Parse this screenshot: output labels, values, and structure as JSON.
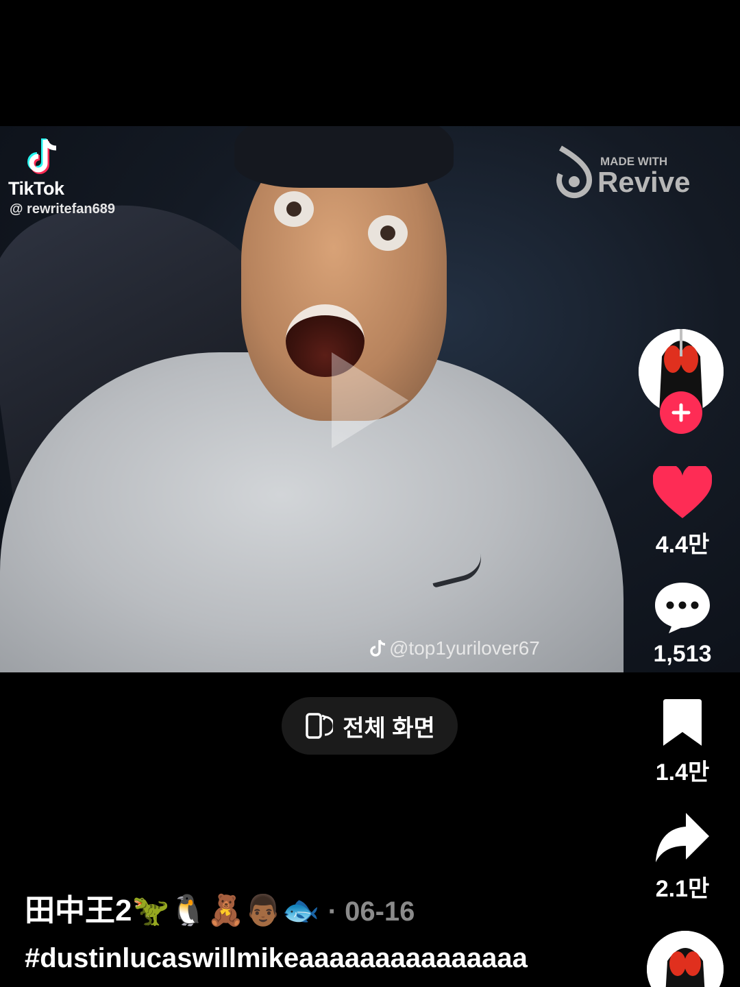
{
  "video": {
    "tiktok_wordmark": "TikTok",
    "tiktok_username": "@ rewritefan689",
    "revive_small": "MADE WITH",
    "revive_big": "Revive",
    "watermark_handle": "@top1yurilover67"
  },
  "fullscreen_button": {
    "label": "전체 화면",
    "icon": "rotate-phone-icon"
  },
  "rail": {
    "like_count": "4.4만",
    "comment_count": "1,513",
    "save_count": "1.4만",
    "share_count": "2.1만",
    "like_color": "#fe2c55",
    "follow_color": "#fe2c55"
  },
  "caption": {
    "title": "田中王2🦖🐧🧸👨🏾🐟",
    "date": "· 06-16",
    "hashtags": "#dustinlucaswillmikeaaaaaaaaaaaaaaa"
  }
}
